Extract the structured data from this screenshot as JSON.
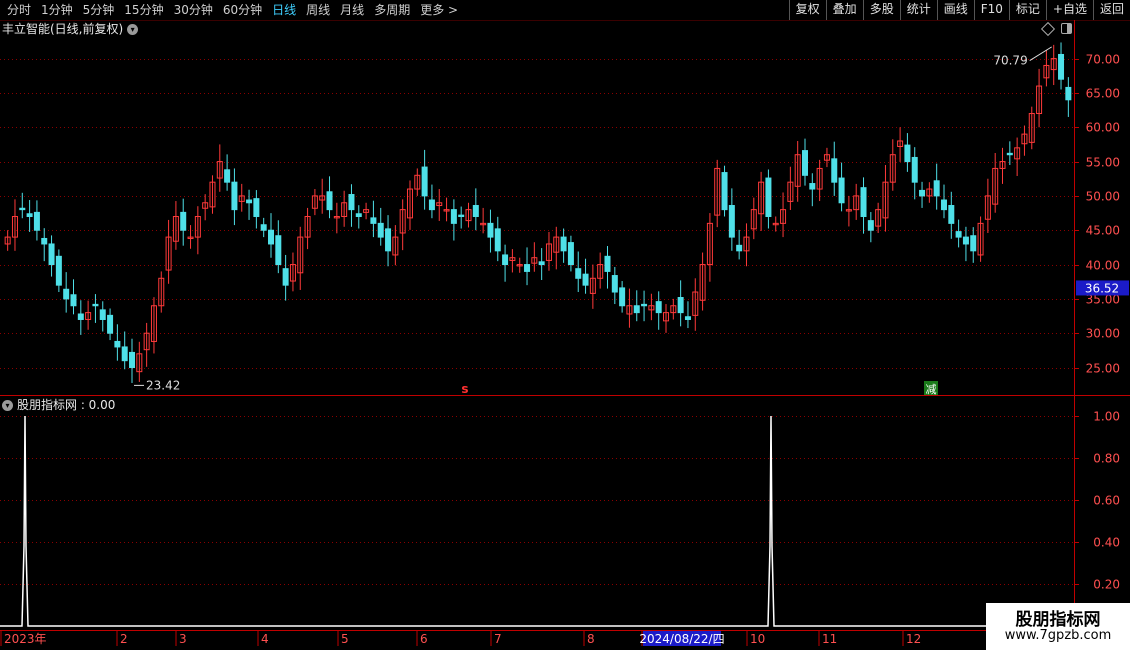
{
  "toolbar": {
    "periods": [
      "分时",
      "1分钟",
      "5分钟",
      "15分钟",
      "30分钟",
      "60分钟",
      "日线",
      "周线",
      "月线",
      "多周期",
      "更多 >"
    ],
    "active": "日线",
    "buttons": [
      "复权",
      "叠加",
      "多股",
      "统计",
      "画线",
      "F10",
      "标记",
      "+自选",
      "返回"
    ]
  },
  "stock_title": "丰立智能(日线,前复权)",
  "indicator_title": "股朋指标网 : 0.00",
  "price_axis": [
    "70.00",
    "65.00",
    "60.00",
    "55.00",
    "50.00",
    "45.00",
    "40.00",
    "35.00",
    "30.00",
    "25.00"
  ],
  "indicator_axis": [
    "1.00",
    "0.80",
    "0.60",
    "0.40",
    "0.20"
  ],
  "current_price": "36.52",
  "high_label": "70.79",
  "low_label": "23.42",
  "markers": {
    "s": "s",
    "reduce": "减"
  },
  "date_axis": [
    "2023年",
    "2",
    "3",
    "4",
    "5",
    "6",
    "7",
    "8",
    "2024/08/22/四",
    "10",
    "11",
    "12"
  ],
  "watermark": {
    "line1": "股朋指标网",
    "line2": "www.7gpzb.com"
  },
  "colors": {
    "up": "#ff3a3a",
    "down": "#4fe0e8",
    "grid": "#8a0000",
    "axis": "#c00000",
    "signal": "#ffffff"
  },
  "chart_data": [
    {
      "type": "candlestick",
      "title": "丰立智能(日线,前复权)",
      "ylim": [
        21,
        73
      ],
      "y_ticks": [
        25,
        30,
        35,
        40,
        45,
        50,
        55,
        60,
        65,
        70
      ],
      "series": [
        {
          "name": "close",
          "values": [
            44,
            47,
            48,
            47,
            45,
            43,
            40,
            37,
            35,
            34,
            32,
            33,
            34,
            32,
            30,
            28,
            26,
            25,
            27,
            30,
            34,
            38,
            44,
            47,
            45,
            44,
            47,
            49,
            52,
            55,
            52,
            48,
            50,
            49,
            47,
            45,
            43,
            40,
            37,
            40,
            44,
            47,
            50,
            50,
            48,
            47,
            49,
            48,
            47,
            48,
            46,
            44,
            42,
            44,
            48,
            51,
            53,
            50,
            48,
            49,
            48,
            46,
            47,
            48,
            47,
            46,
            44,
            42,
            40,
            41,
            40,
            39,
            41,
            40,
            43,
            44,
            42,
            40,
            38,
            37,
            38,
            40,
            39,
            36,
            34,
            34,
            33,
            34,
            34,
            33,
            33,
            34,
            33,
            32,
            36,
            40,
            46,
            54,
            48,
            44,
            42,
            44,
            48,
            52,
            47,
            46,
            48,
            52,
            56,
            53,
            51,
            54,
            56,
            52,
            49,
            48,
            50,
            47,
            45,
            48,
            52,
            56,
            58,
            55,
            52,
            50,
            51,
            50,
            48,
            46,
            44,
            43,
            42,
            46,
            50,
            54,
            55,
            56,
            57,
            59,
            62,
            66,
            69,
            70,
            67,
            64
          ]
        }
      ],
      "annotations": [
        {
          "label": "70.79",
          "kind": "high"
        },
        {
          "label": "23.42",
          "kind": "low"
        },
        {
          "label": "36.52",
          "kind": "last"
        }
      ]
    },
    {
      "type": "line",
      "title": "股朋指标网",
      "ylim": [
        0,
        1.05
      ],
      "y_ticks": [
        0.2,
        0.4,
        0.6,
        0.8,
        1.0
      ],
      "series": [
        {
          "name": "股朋指标网",
          "signals": [
            {
              "at": "2023年1月",
              "value": 1.0
            },
            {
              "at": "2024/08/22",
              "value": 1.0
            }
          ]
        }
      ]
    }
  ]
}
